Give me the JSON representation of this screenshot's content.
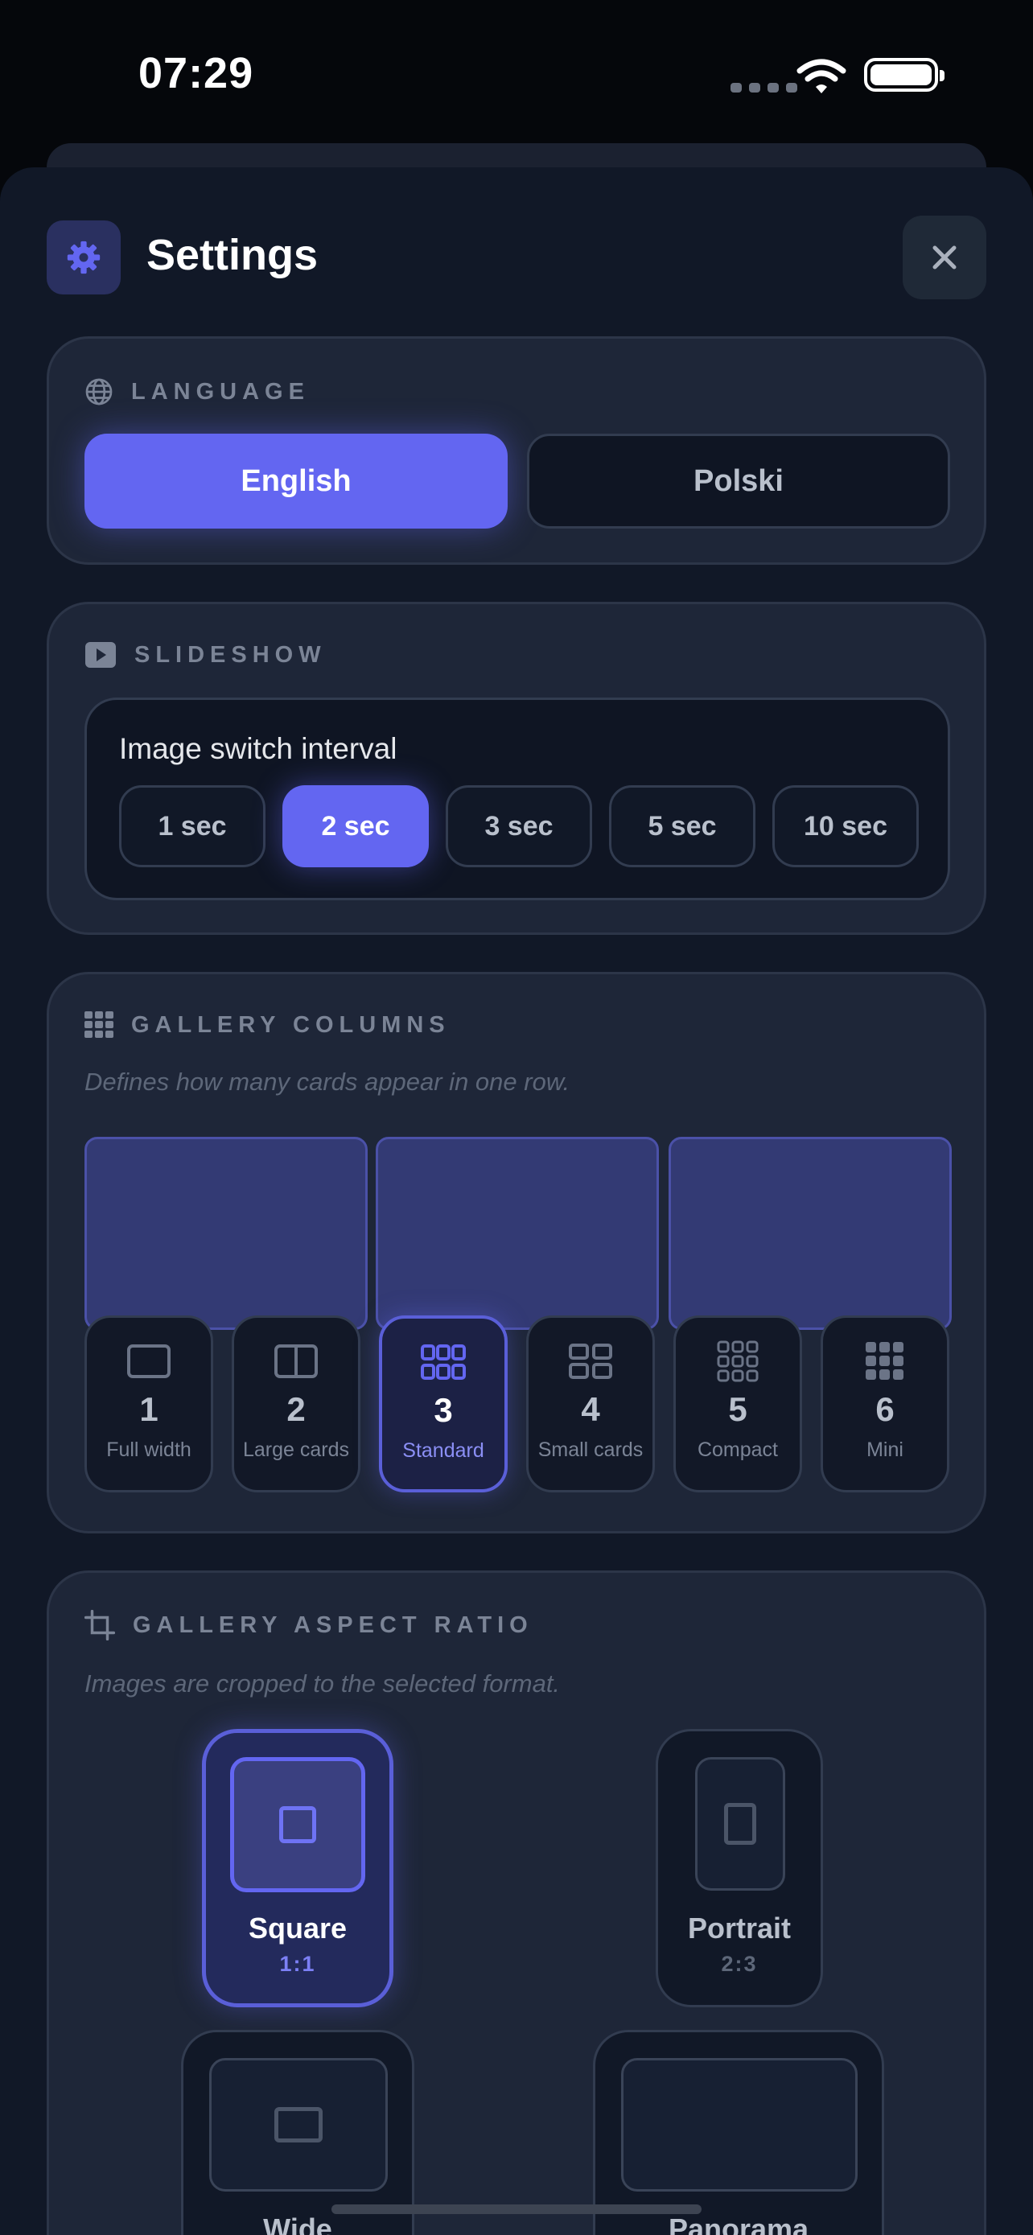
{
  "status_bar": {
    "time": "07:29"
  },
  "header": {
    "title": "Settings"
  },
  "colors": {
    "accent": "#6366f1",
    "background": "#111827",
    "card": "#1e2638"
  },
  "icons": {
    "settings": "gear-icon",
    "close": "close-icon",
    "language": "globe-icon",
    "slideshow": "play-icon",
    "columns": "grid-icon",
    "aspect": "crop-icon"
  },
  "language": {
    "title": "LANGUAGE",
    "options": [
      "English",
      "Polski"
    ],
    "selected": "English"
  },
  "slideshow": {
    "title": "SLIDESHOW",
    "label": "Image switch interval",
    "options": [
      "1 sec",
      "2 sec",
      "3 sec",
      "5 sec",
      "10 sec"
    ],
    "selected": "2 sec"
  },
  "gallery_columns": {
    "title": "GALLERY COLUMNS",
    "description": "Defines how many cards appear in one row.",
    "options": [
      {
        "num": "1",
        "label": "Full width"
      },
      {
        "num": "2",
        "label": "Large cards"
      },
      {
        "num": "3",
        "label": "Standard"
      },
      {
        "num": "4",
        "label": "Small cards"
      },
      {
        "num": "5",
        "label": "Compact"
      },
      {
        "num": "6",
        "label": "Mini"
      }
    ],
    "selected": "3"
  },
  "gallery_aspect": {
    "title": "GALLERY ASPECT RATIO",
    "description": "Images are cropped to the selected format.",
    "options": [
      {
        "name": "Square",
        "ratio": "1:1"
      },
      {
        "name": "Portrait",
        "ratio": "2:3"
      },
      {
        "name": "Wide",
        "ratio": ""
      },
      {
        "name": "Panorama",
        "ratio": ""
      }
    ],
    "selected": "Square"
  }
}
